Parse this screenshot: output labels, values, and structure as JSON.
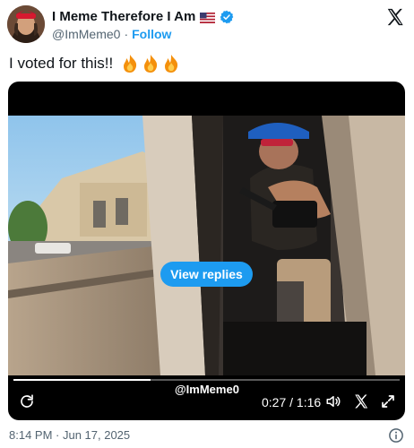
{
  "header": {
    "display_name": "I Meme Therefore I Am",
    "handle": "@ImMeme0",
    "separator": "·",
    "follow_label": "Follow",
    "icons": [
      "avatar",
      "us-flag-icon",
      "verified-badge-icon",
      "x-logo-icon"
    ]
  },
  "tweet": {
    "text": "I voted for this!!",
    "emoji": [
      "fire-icon",
      "fire-icon",
      "fire-icon"
    ]
  },
  "video": {
    "overlay_button": "View replies",
    "watermark": "@ImMeme0",
    "time_display": "0:27 / 1:16",
    "progress": 0.355,
    "controls": [
      "replay-icon",
      "volume-icon",
      "x-icon",
      "fullscreen-icon"
    ]
  },
  "footer": {
    "timestamp": "8:14 PM · Jun 17, 2025",
    "info_icon": "info-icon"
  },
  "colors": {
    "accent": "#1d9bf0",
    "text": "#0f1419",
    "muted": "#536471"
  }
}
